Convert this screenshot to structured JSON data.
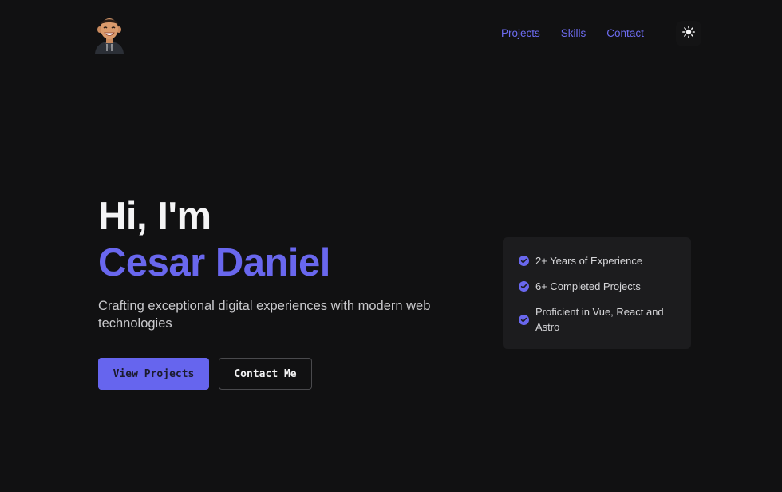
{
  "header": {
    "avatar_icon": "memoji-avatar-icon",
    "nav": {
      "projects": "Projects",
      "skills": "Skills",
      "contact": "Contact"
    },
    "theme_toggle_icon": "sun-icon"
  },
  "hero": {
    "greeting": "Hi, I'm",
    "name": "Cesar Daniel",
    "tagline": "Crafting exceptional digital experiences with modern web technologies",
    "primary_button": "View Projects",
    "secondary_button": "Contact Me"
  },
  "highlights": {
    "items": [
      "2+ Years of Experience",
      "6+ Completed Projects",
      "Proficient in Vue, React and Astro"
    ],
    "item_icon": "check-circle-icon"
  },
  "colors": {
    "background": "#111112",
    "accent": "#6967ee",
    "card": "#1c1c1e",
    "text": "#f4f4f5"
  }
}
